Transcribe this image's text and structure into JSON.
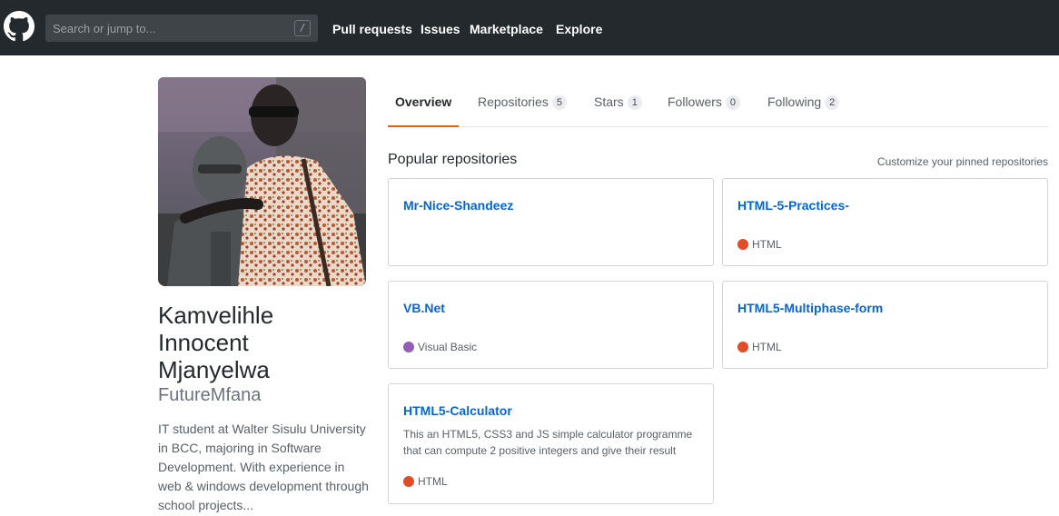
{
  "header": {
    "search": {
      "placeholder": "Search or jump to...",
      "shortcut": "/"
    },
    "nav": [
      "Pull requests",
      "Issues",
      "Marketplace",
      "Explore"
    ]
  },
  "profile": {
    "name_lines": [
      "Kamvelihle",
      "Innocent",
      "Mjanyelwa"
    ],
    "username": "FutureMfana",
    "bio": "IT student at Walter Sisulu University in BCC, majoring in Software Development. With experience in web & windows development through school projects..."
  },
  "tabs": [
    {
      "label": "Overview",
      "count": "",
      "selected": true
    },
    {
      "label": "Repositories",
      "count": "5",
      "selected": false
    },
    {
      "label": "Stars",
      "count": "1",
      "selected": false
    },
    {
      "label": "Followers",
      "count": "0",
      "selected": false
    },
    {
      "label": "Following",
      "count": "2",
      "selected": false
    }
  ],
  "popular": {
    "title": "Popular repositories",
    "customize": "Customize your pinned repositories",
    "repos": [
      {
        "name": "Mr-Nice-Shandeez",
        "description": "",
        "language": "",
        "language_color": ""
      },
      {
        "name": "HTML-5-Practices-",
        "description": "",
        "language": "HTML",
        "language_color": "#e34c26"
      },
      {
        "name": "VB.Net",
        "description": "",
        "language": "Visual Basic",
        "language_color": "#945db7"
      },
      {
        "name": "HTML5-Multiphase-form",
        "description": "",
        "language": "HTML",
        "language_color": "#e34c26"
      },
      {
        "name": "HTML5-Calculator",
        "description": "This an HTML5, CSS3 and JS simple calculator programme that can compute 2 positive integers and give their result",
        "language": "HTML",
        "language_color": "#e34c26"
      }
    ]
  },
  "icons": {
    "logo": "github-octocat-icon"
  }
}
